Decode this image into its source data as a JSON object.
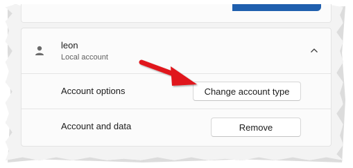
{
  "user": {
    "name": "leon",
    "account_type": "Local account"
  },
  "options": {
    "account_options_label": "Account options",
    "change_type_button": "Change account type",
    "account_data_label": "Account and data",
    "remove_button": "Remove"
  },
  "icons": {
    "avatar": "person-icon",
    "collapse": "chevron-up-icon",
    "annotation": "red-arrow-annotation"
  },
  "colors": {
    "accent_blue": "#1f5fae",
    "annotation_red": "#e0141a"
  }
}
